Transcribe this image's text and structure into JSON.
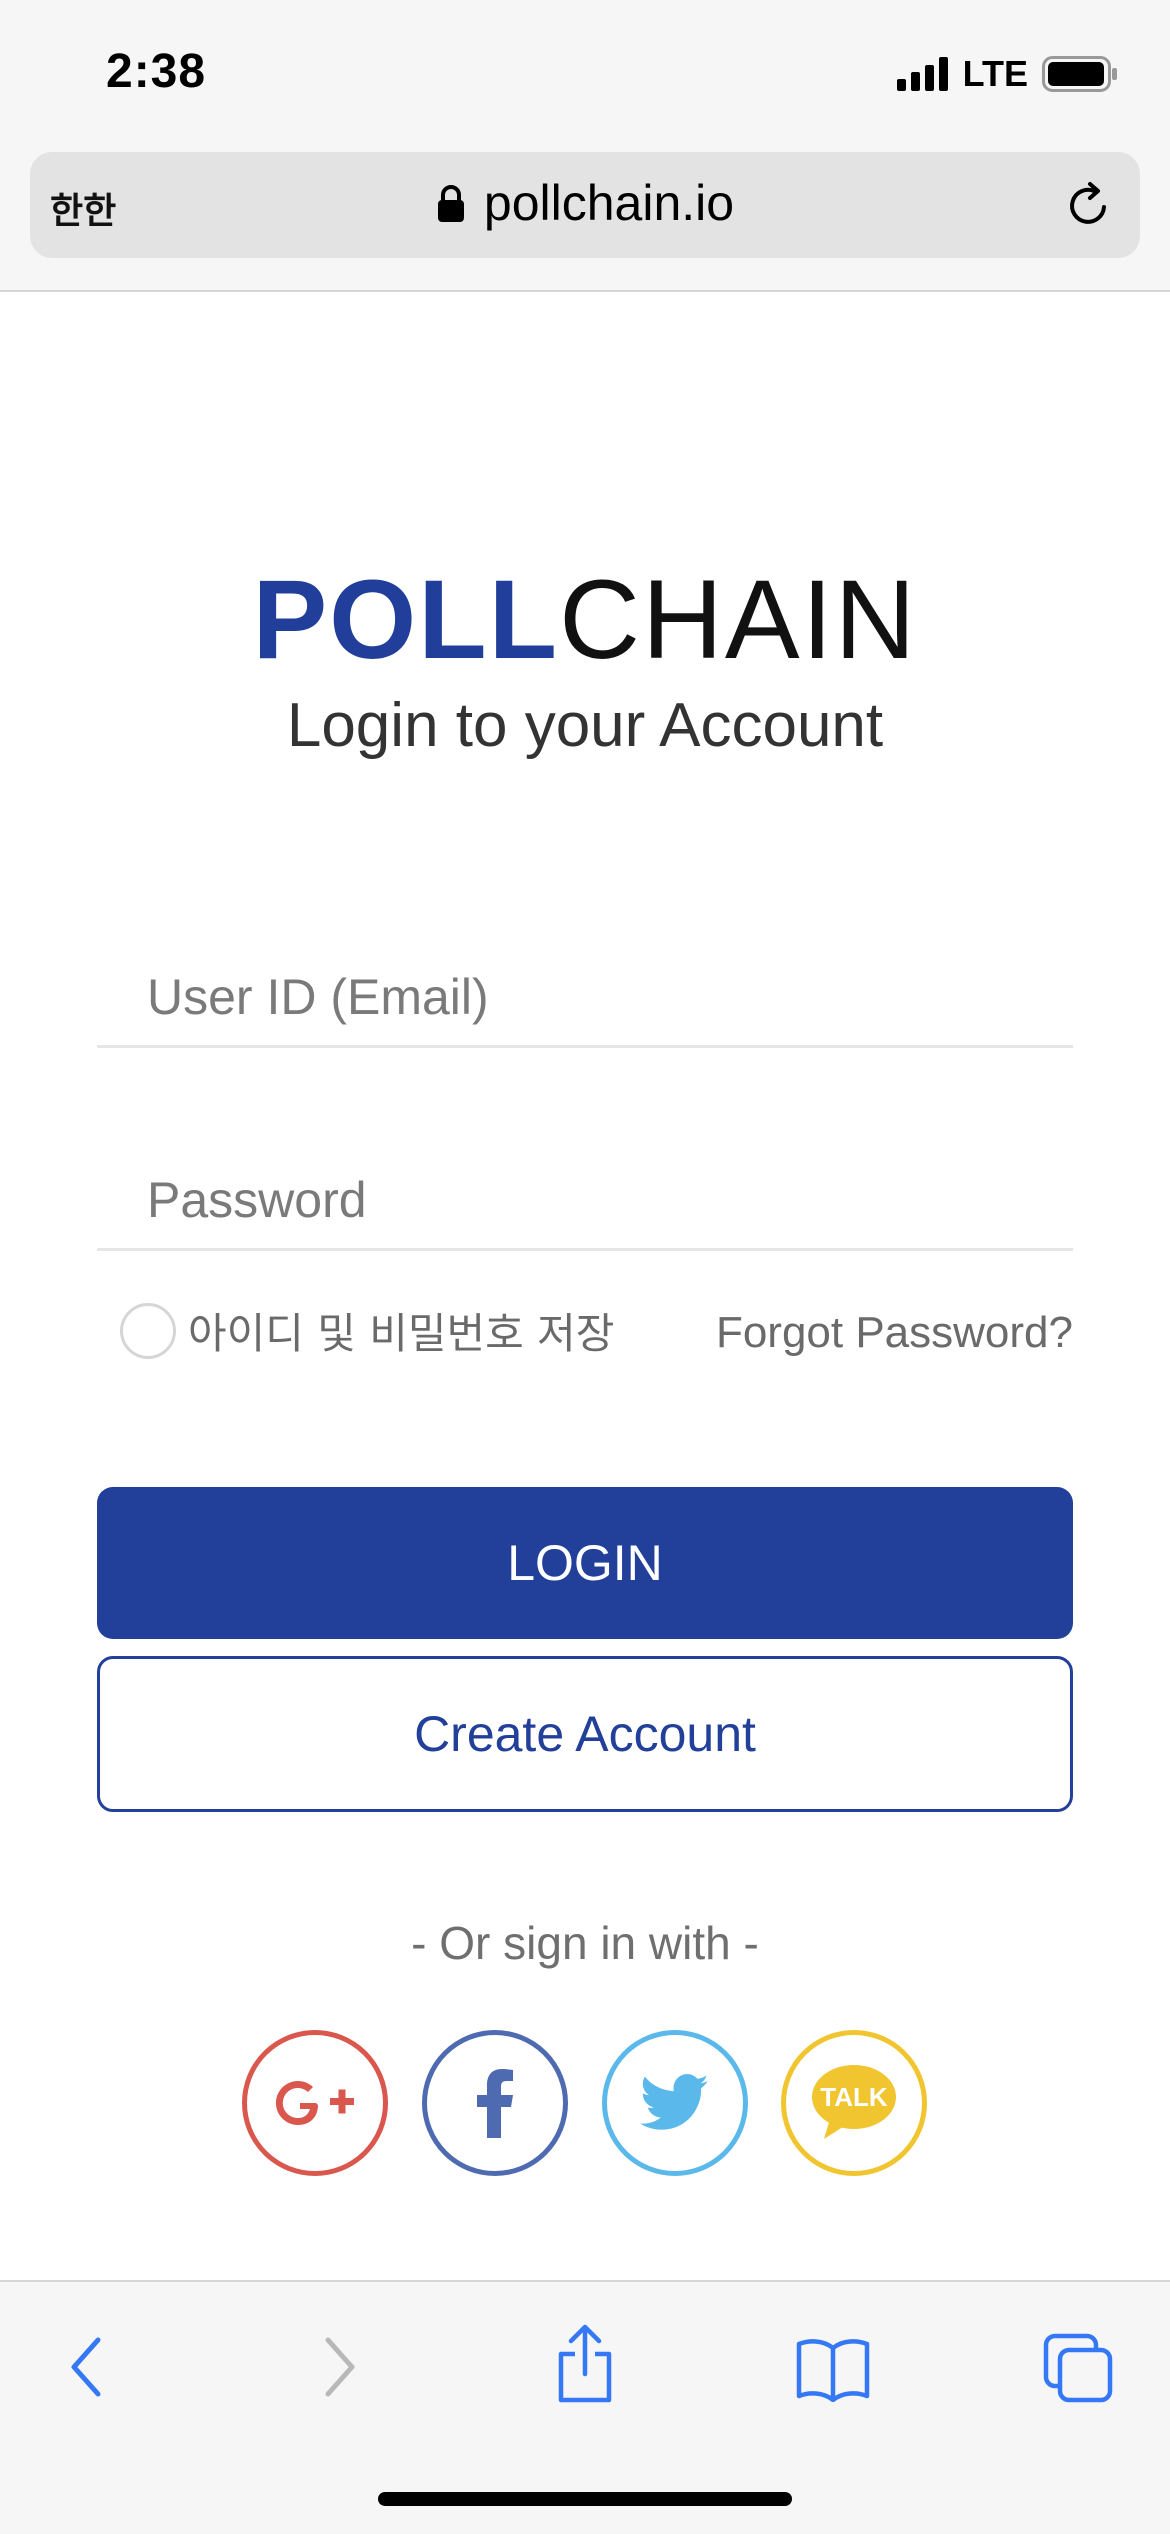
{
  "status_bar": {
    "time": "2:38",
    "carrier": "LTE"
  },
  "browser": {
    "text_size_label": "한한",
    "url": "pollchain.io"
  },
  "logo": {
    "part1": "POLL",
    "part2": "CHAIN"
  },
  "page": {
    "subtitle": "Login to your Account"
  },
  "form": {
    "email_placeholder": "User ID (Email)",
    "password_placeholder": "Password",
    "remember_label": "아이디 및 비밀번호 저장",
    "forgot_label": "Forgot Password?",
    "login_label": "LOGIN",
    "create_label": "Create Account"
  },
  "social": {
    "heading": "- Or sign in with -",
    "providers": [
      "google-plus",
      "facebook",
      "twitter",
      "kakaotalk"
    ],
    "kakao_text": "TALK"
  },
  "colors": {
    "brand_blue": "#223f99",
    "google": "#d9574c",
    "facebook": "#4e6ab1",
    "twitter": "#5bb8ea",
    "kakao": "#f1c52f",
    "ios_blue": "#3478f6"
  }
}
